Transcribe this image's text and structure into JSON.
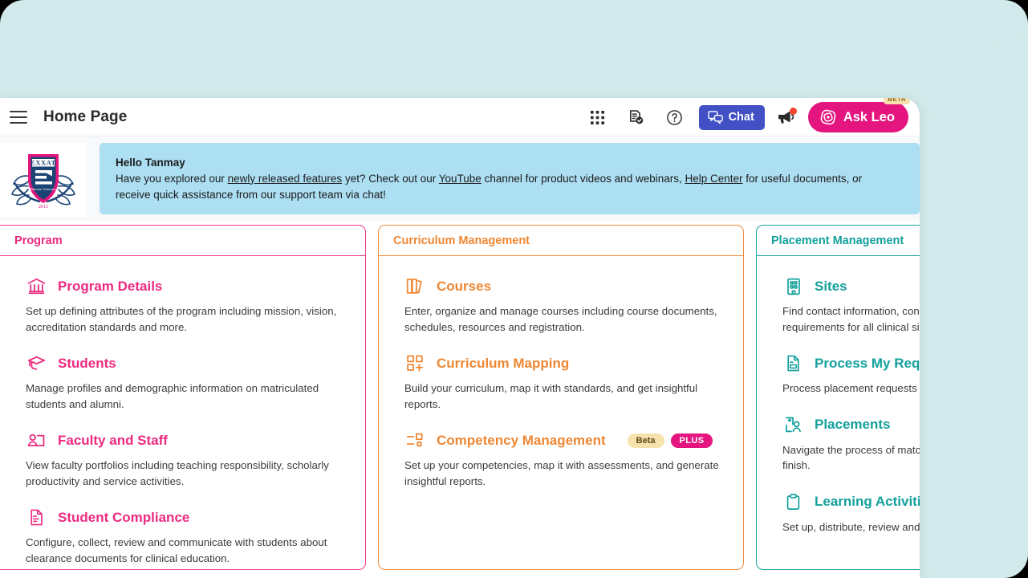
{
  "header": {
    "page_title": "Home Page",
    "menu_icon": "hamburger-menu-icon",
    "apps_icon": "apps-grid-icon",
    "tasks_icon": "document-check-icon",
    "help_icon": "question-circle-icon",
    "chat_label": "Chat",
    "chat_icon": "chat-bubbles-icon",
    "announcement_icon": "megaphone-icon",
    "ask_leo_label": "Ask Leo",
    "ask_leo_icon": "leo-swirl-icon",
    "beta_badge": "BETA",
    "colors": {
      "chat": "#4250c5",
      "ask_leo": "#e4157f",
      "beta": "#f6e0b0",
      "notification_dot": "#f4442e"
    }
  },
  "logo": {
    "name": "EXXAT",
    "year": "2011",
    "alt": "exxat-crest-logo"
  },
  "greeting": {
    "title": "Hello Tanmay",
    "line1_a": "Have you explored our ",
    "link1": "newly released features",
    "line1_b": " yet? Check out our ",
    "link2": "YouTube",
    "line1_c": " channel for product videos and webinars, ",
    "link3": "Help Center",
    "line1_d": " for useful documents, or receive quick",
    "line2": "assistance from our support team via chat!",
    "background": "#addff3"
  },
  "cards": [
    {
      "title": "Program",
      "accent": "#ec2a80",
      "items": [
        {
          "icon": "bank-columns-icon",
          "title": "Program Details",
          "desc": "Set up defining attributes of the program including mission, vision, accreditation standards and more.",
          "badges": []
        },
        {
          "icon": "graduation-cap-icon",
          "title": "Students",
          "desc": "Manage profiles and demographic information on matriculated students and alumni.",
          "badges": []
        },
        {
          "icon": "person-card-icon",
          "title": "Faculty and Staff",
          "desc": "View faculty portfolios including teaching responsibility, scholarly productivity and service activities.",
          "badges": []
        },
        {
          "icon": "document-lines-icon",
          "title": "Student Compliance",
          "desc": "Configure, collect, review and communicate with students about clearance documents for clinical education.",
          "badges": []
        }
      ]
    },
    {
      "title": "Curriculum Management",
      "accent": "#ef8733",
      "items": [
        {
          "icon": "books-icon",
          "title": "Courses",
          "desc": "Enter, organize and manage courses including course documents, schedules, resources and registration.",
          "badges": []
        },
        {
          "icon": "grid-plus-icon",
          "title": "Curriculum Mapping",
          "desc": "Build your curriculum, map it with standards, and get insightful reports.",
          "badges": []
        },
        {
          "icon": "competency-bars-icon",
          "title": "Competency Management",
          "desc": "Set up your competencies, map it with assessments, and generate insightful reports.",
          "badges": [
            "Beta",
            "PLUS"
          ]
        }
      ]
    },
    {
      "title": "Placement Management",
      "accent": "#13a09c",
      "items": [
        {
          "icon": "building-icon",
          "title": "Sites",
          "desc": "Find contact information, contract details and onboarding requirements for all clinical sites.",
          "badges": []
        },
        {
          "icon": "request-document-icon",
          "title": "Process My Requests",
          "desc": "Process placement requests submitted by students.",
          "badges": []
        },
        {
          "icon": "placement-person-icon",
          "title": "Placements",
          "desc": "Navigate the process of matching students to sites from start to finish.",
          "badges": []
        },
        {
          "icon": "clipboard-icon",
          "title": "Learning Activities",
          "desc": "Set up, distribute, review and grade learning activities.",
          "badges": []
        }
      ]
    }
  ]
}
